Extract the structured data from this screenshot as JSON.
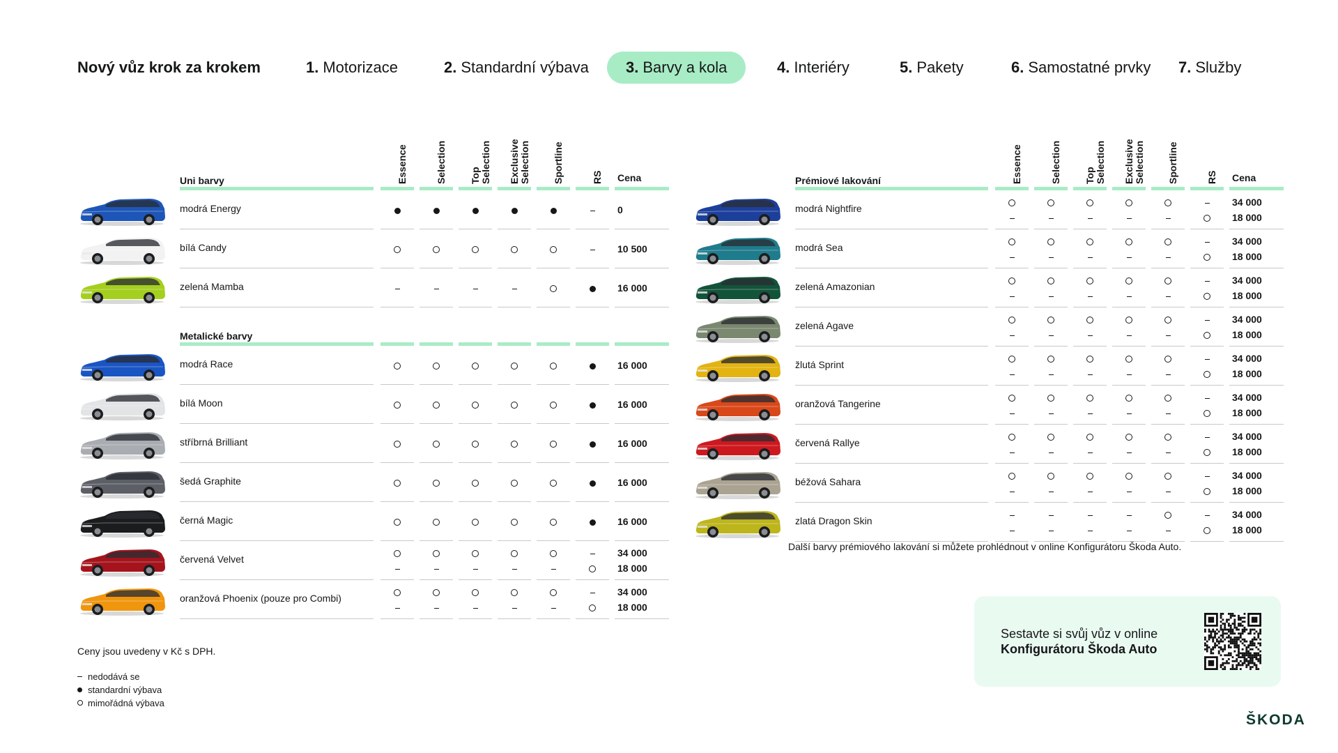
{
  "nav": {
    "title": "Nový vůz krok za krokem",
    "steps": [
      {
        "num": "1.",
        "label": "Motorizace"
      },
      {
        "num": "2.",
        "label": "Standardní výbava"
      },
      {
        "num": "3.",
        "label": "Barvy a kola"
      },
      {
        "num": "4.",
        "label": "Interiéry"
      },
      {
        "num": "5.",
        "label": "Pakety"
      },
      {
        "num": "6.",
        "label": "Samostatné prvky"
      },
      {
        "num": "7.",
        "label": "Služby"
      }
    ],
    "active_step": 3
  },
  "columns": [
    "Essence",
    "Selection",
    "Top\nSelection",
    "Exclusive\nSelection",
    "Sportline",
    "RS"
  ],
  "price_header": "Cena",
  "left": {
    "uni_title": "Uni barvy",
    "uni": [
      {
        "name": "modrá Energy",
        "color": "#1d56b8",
        "cells": [
          [
            "dot"
          ],
          [
            "dot"
          ],
          [
            "dot"
          ],
          [
            "dot"
          ],
          [
            "dot"
          ],
          [
            "dash"
          ]
        ],
        "prices": [
          "0"
        ]
      },
      {
        "name": "bílá Candy",
        "color": "#f2f2f2",
        "cells": [
          [
            "ring"
          ],
          [
            "ring"
          ],
          [
            "ring"
          ],
          [
            "ring"
          ],
          [
            "ring"
          ],
          [
            "dash"
          ]
        ],
        "prices": [
          "10 500"
        ]
      },
      {
        "name": "zelená Mamba",
        "color": "#a5cf1e",
        "cells": [
          [
            "dash"
          ],
          [
            "dash"
          ],
          [
            "dash"
          ],
          [
            "dash"
          ],
          [
            "ring"
          ],
          [
            "dot"
          ]
        ],
        "prices": [
          "16 000"
        ]
      }
    ],
    "metal_title": "Metalické barvy",
    "metal": [
      {
        "name": "modrá Race",
        "color": "#1a55c4",
        "cells": [
          [
            "ring"
          ],
          [
            "ring"
          ],
          [
            "ring"
          ],
          [
            "ring"
          ],
          [
            "ring"
          ],
          [
            "dot"
          ]
        ],
        "prices": [
          "16 000"
        ]
      },
      {
        "name": "bílá Moon",
        "color": "#e2e4e6",
        "cells": [
          [
            "ring"
          ],
          [
            "ring"
          ],
          [
            "ring"
          ],
          [
            "ring"
          ],
          [
            "ring"
          ],
          [
            "dot"
          ]
        ],
        "prices": [
          "16 000"
        ]
      },
      {
        "name": "stříbrná Brilliant",
        "color": "#a9acb1",
        "cells": [
          [
            "ring"
          ],
          [
            "ring"
          ],
          [
            "ring"
          ],
          [
            "ring"
          ],
          [
            "ring"
          ],
          [
            "dot"
          ]
        ],
        "prices": [
          "16 000"
        ]
      },
      {
        "name": "šedá Graphite",
        "color": "#5c6066",
        "cells": [
          [
            "ring"
          ],
          [
            "ring"
          ],
          [
            "ring"
          ],
          [
            "ring"
          ],
          [
            "ring"
          ],
          [
            "dot"
          ]
        ],
        "prices": [
          "16 000"
        ]
      },
      {
        "name": "černá Magic",
        "color": "#1b1c1e",
        "cells": [
          [
            "ring"
          ],
          [
            "ring"
          ],
          [
            "ring"
          ],
          [
            "ring"
          ],
          [
            "ring"
          ],
          [
            "dot"
          ]
        ],
        "prices": [
          "16 000"
        ]
      },
      {
        "name": "červená Velvet",
        "color": "#a5141c",
        "cells": [
          [
            "ring",
            "dash"
          ],
          [
            "ring",
            "dash"
          ],
          [
            "ring",
            "dash"
          ],
          [
            "ring",
            "dash"
          ],
          [
            "ring",
            "dash"
          ],
          [
            "dash",
            "ring"
          ]
        ],
        "prices": [
          "34 000",
          "18 000"
        ]
      },
      {
        "name": "oranžová Phoenix (pouze pro Combi)",
        "color": "#f0950e",
        "cells": [
          [
            "ring",
            "dash"
          ],
          [
            "ring",
            "dash"
          ],
          [
            "ring",
            "dash"
          ],
          [
            "ring",
            "dash"
          ],
          [
            "ring",
            "dash"
          ],
          [
            "dash",
            "ring"
          ]
        ],
        "prices": [
          "34 000",
          "18 000"
        ]
      }
    ]
  },
  "right": {
    "title": "Prémiové lakování",
    "rows": [
      {
        "name": "modrá Nightfire",
        "color": "#1d3f9c",
        "cells": [
          [
            "ring",
            "dash"
          ],
          [
            "ring",
            "dash"
          ],
          [
            "ring",
            "dash"
          ],
          [
            "ring",
            "dash"
          ],
          [
            "ring",
            "dash"
          ],
          [
            "dash",
            "ring"
          ]
        ],
        "prices": [
          "34 000",
          "18 000"
        ]
      },
      {
        "name": "modrá Sea",
        "color": "#1f7c8c",
        "cells": [
          [
            "ring",
            "dash"
          ],
          [
            "ring",
            "dash"
          ],
          [
            "ring",
            "dash"
          ],
          [
            "ring",
            "dash"
          ],
          [
            "ring",
            "dash"
          ],
          [
            "dash",
            "ring"
          ]
        ],
        "prices": [
          "34 000",
          "18 000"
        ]
      },
      {
        "name": "zelená Amazonian",
        "color": "#12543a",
        "cells": [
          [
            "ring",
            "dash"
          ],
          [
            "ring",
            "dash"
          ],
          [
            "ring",
            "dash"
          ],
          [
            "ring",
            "dash"
          ],
          [
            "ring",
            "dash"
          ],
          [
            "dash",
            "ring"
          ]
        ],
        "prices": [
          "34 000",
          "18 000"
        ]
      },
      {
        "name": "zelená Agave",
        "color": "#7b8870",
        "cells": [
          [
            "ring",
            "dash"
          ],
          [
            "ring",
            "dash"
          ],
          [
            "ring",
            "dash"
          ],
          [
            "ring",
            "dash"
          ],
          [
            "ring",
            "dash"
          ],
          [
            "dash",
            "ring"
          ]
        ],
        "prices": [
          "34 000",
          "18 000"
        ]
      },
      {
        "name": "žlutá Sprint",
        "color": "#e3b312",
        "cells": [
          [
            "ring",
            "dash"
          ],
          [
            "ring",
            "dash"
          ],
          [
            "ring",
            "dash"
          ],
          [
            "ring",
            "dash"
          ],
          [
            "ring",
            "dash"
          ],
          [
            "dash",
            "ring"
          ]
        ],
        "prices": [
          "34 000",
          "18 000"
        ]
      },
      {
        "name": "oranžová Tangerine",
        "color": "#d9481a",
        "cells": [
          [
            "ring",
            "dash"
          ],
          [
            "ring",
            "dash"
          ],
          [
            "ring",
            "dash"
          ],
          [
            "ring",
            "dash"
          ],
          [
            "ring",
            "dash"
          ],
          [
            "dash",
            "ring"
          ]
        ],
        "prices": [
          "34 000",
          "18 000"
        ]
      },
      {
        "name": "červená Rallye",
        "color": "#cc1920",
        "cells": [
          [
            "ring",
            "dash"
          ],
          [
            "ring",
            "dash"
          ],
          [
            "ring",
            "dash"
          ],
          [
            "ring",
            "dash"
          ],
          [
            "ring",
            "dash"
          ],
          [
            "dash",
            "ring"
          ]
        ],
        "prices": [
          "34 000",
          "18 000"
        ]
      },
      {
        "name": "béžová Sahara",
        "color": "#aba392",
        "cells": [
          [
            "ring",
            "dash"
          ],
          [
            "ring",
            "dash"
          ],
          [
            "ring",
            "dash"
          ],
          [
            "ring",
            "dash"
          ],
          [
            "ring",
            "dash"
          ],
          [
            "dash",
            "ring"
          ]
        ],
        "prices": [
          "34 000",
          "18 000"
        ]
      },
      {
        "name": "zlatá Dragon Skin",
        "color": "#bdb51c",
        "cells": [
          [
            "dash",
            "dash"
          ],
          [
            "dash",
            "dash"
          ],
          [
            "dash",
            "dash"
          ],
          [
            "dash",
            "dash"
          ],
          [
            "ring",
            "dash"
          ],
          [
            "dash",
            "ring"
          ]
        ],
        "prices": [
          "34 000",
          "18 000"
        ]
      }
    ],
    "note": "Další barvy prémiového lakování si můžete prohlédnout v online Konfigurátoru Škoda Auto."
  },
  "footer": {
    "vat_note": "Ceny jsou uvedeny v Kč s DPH.",
    "legend": [
      {
        "mark": "dash",
        "text": "nedodává se"
      },
      {
        "mark": "dot",
        "text": "standardní výbava"
      },
      {
        "mark": "ring",
        "text": "mimořádná výbava"
      }
    ],
    "promo_line1": "Sestavte si svůj vůz v online",
    "promo_line2": "Konfigurátoru Škoda Auto",
    "brand": "ŠKODA"
  }
}
